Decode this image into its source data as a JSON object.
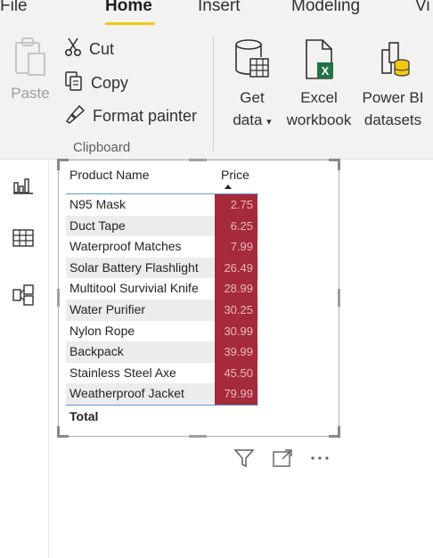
{
  "tabs": [
    {
      "label": "File"
    },
    {
      "label": "Home"
    },
    {
      "label": "Insert"
    },
    {
      "label": "Modeling"
    },
    {
      "label": "Vi"
    }
  ],
  "ribbon": {
    "clipboard": {
      "paste_label": "Paste",
      "cut_label": "Cut",
      "copy_label": "Copy",
      "format_painter_label": "Format painter",
      "group_label": "Clipboard"
    },
    "data": {
      "get_data": {
        "line1": "Get",
        "line2": "data"
      },
      "excel": {
        "line1": "Excel",
        "line2": "workbook"
      },
      "power_bi": {
        "line1": "Power BI",
        "line2": "datasets"
      }
    }
  },
  "rail": [
    {
      "icon": "report-view-icon"
    },
    {
      "icon": "data-view-icon"
    },
    {
      "icon": "model-view-icon"
    }
  ],
  "table": {
    "columns": [
      "Product Name",
      "Price"
    ],
    "sort": {
      "column": "Price",
      "direction": "ascending"
    },
    "rows": [
      {
        "name": "N95 Mask",
        "price": "2.75"
      },
      {
        "name": "Duct Tape",
        "price": "6.25"
      },
      {
        "name": "Waterproof Matches",
        "price": "7.99"
      },
      {
        "name": "Solar Battery Flashlight",
        "price": "26.49"
      },
      {
        "name": "Multitool Survivial Knife",
        "price": "28.99"
      },
      {
        "name": "Water Purifier",
        "price": "30.25"
      },
      {
        "name": "Nylon Rope",
        "price": "30.99"
      },
      {
        "name": "Backpack",
        "price": "39.99"
      },
      {
        "name": "Stainless Steel Axe",
        "price": "45.50"
      },
      {
        "name": "Weatherproof Jacket",
        "price": "79.99"
      }
    ],
    "total_label": "Total"
  },
  "colors": {
    "accent_tab": "#f2c811",
    "price_fill": "#a52a3a",
    "header_line": "#5b9bd5"
  },
  "visual_toolbar": [
    {
      "icon": "filter-icon"
    },
    {
      "icon": "focus-mode-icon"
    },
    {
      "icon": "more-options-icon"
    }
  ]
}
